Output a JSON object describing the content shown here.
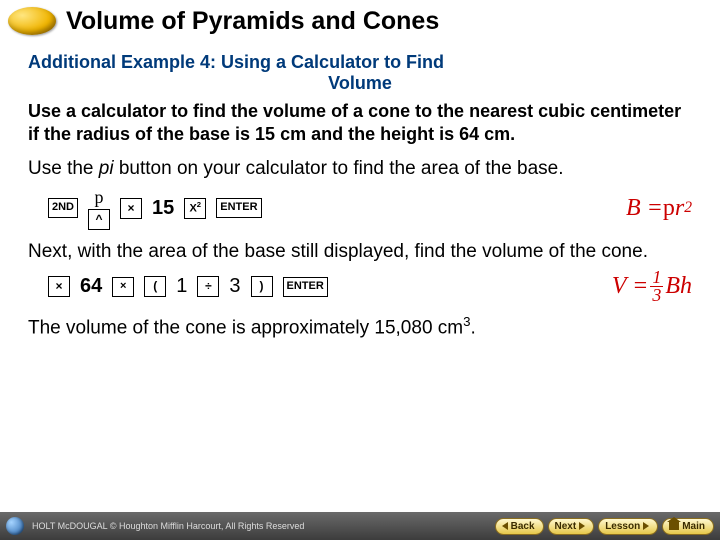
{
  "header": {
    "title": "Volume of Pyramids and Cones"
  },
  "example": {
    "title_line1": "Additional Example 4: Using a Calculator to Find",
    "title_line2": "Volume",
    "prompt": "Use a calculator to find the volume of a cone to the nearest cubic centimeter if the radius of the base is 15 cm and the height is 64 cm.",
    "instr1a": "Use the ",
    "instr1b": "pi",
    "instr1c": " button on your calculator to find the area of the base.",
    "instr2": "Next, with the area of the base still displayed, find the volume of the cone.",
    "final_a": "The volume of the cone is approximately 15,080 cm",
    "final_b": "3",
    "final_c": "."
  },
  "seq1": {
    "pi": "p",
    "k1": "2ND",
    "k2": "^",
    "k3": "×",
    "n1": "15",
    "k4a": "X",
    "k4b": "2",
    "k5": "ENTER",
    "formula_a": "B = ",
    "formula_pi": "p",
    "formula_b": "r",
    "formula_c": "2"
  },
  "seq2": {
    "k1": "×",
    "n1": "64",
    "k2": "×",
    "k3": "(",
    "n2": "1",
    "k4": "÷",
    "n3": "3",
    "k5": ")",
    "k6": "ENTER",
    "formula_a": "V = ",
    "frac_top": "1",
    "frac_bot": "3",
    "formula_b": "Bh"
  },
  "footer": {
    "copy": "HOLT McDOUGAL © Houghton Mifflin Harcourt, All Rights Reserved",
    "back": "Back",
    "next": "Next",
    "lesson": "Lesson",
    "main": "Main"
  }
}
